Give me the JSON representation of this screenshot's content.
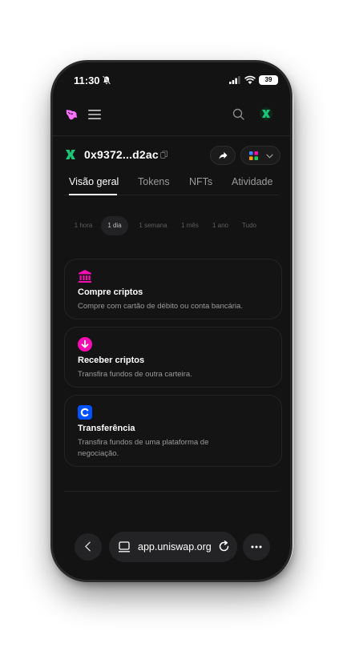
{
  "status_bar": {
    "time": "11:30",
    "battery": "39"
  },
  "account": {
    "address": "0x9372...d2ac"
  },
  "tabs": [
    {
      "label": "Visão geral"
    },
    {
      "label": "Tokens"
    },
    {
      "label": "NFTs"
    },
    {
      "label": "Atividade"
    }
  ],
  "time_range": {
    "options": [
      "1 hora",
      "1 dia",
      "1 semana",
      "1 mês",
      "1 ano",
      "Tudo"
    ],
    "selected": "1 dia"
  },
  "cards": [
    {
      "icon": "bank-icon",
      "title": "Compre criptos",
      "description": "Compre com cartão de débito ou conta bancária."
    },
    {
      "icon": "receive-icon",
      "title": "Receber criptos",
      "description": "Transfira fundos de outra carteira."
    },
    {
      "icon": "coinbase-icon",
      "title": "Transferência",
      "description": "Transfira fundos de uma plataforma de negociação."
    }
  ],
  "browser": {
    "url": "app.uniswap.org"
  },
  "colors": {
    "accent_pink": "#fc72ff",
    "accent_magenta": "#f50db4",
    "avatar_green": "#1cc877",
    "coinbase_blue": "#0052ff",
    "background": "#131313"
  }
}
